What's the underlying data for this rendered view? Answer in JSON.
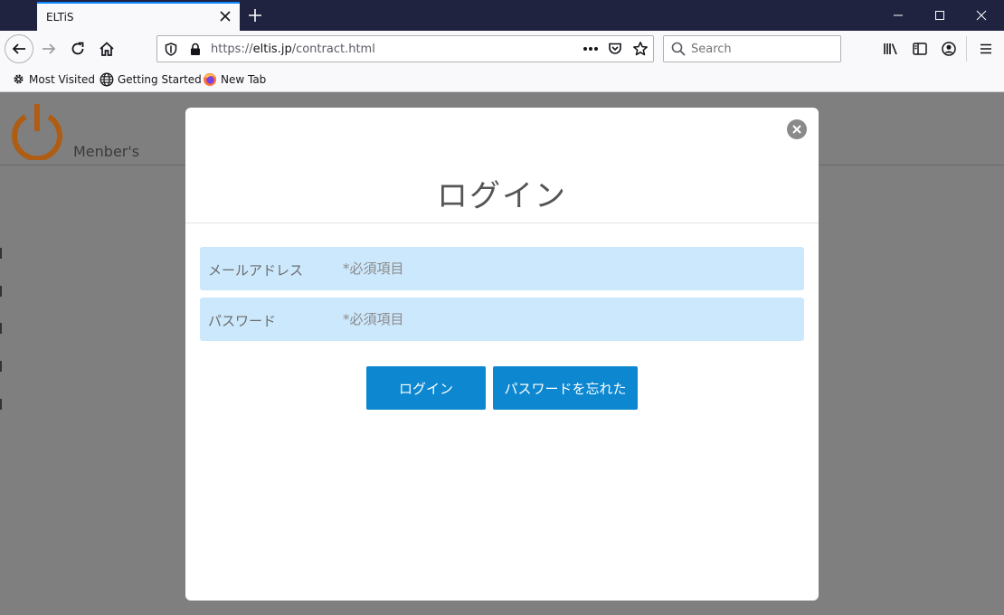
{
  "browser": {
    "tab_title": "ELTiS",
    "url_prefix": "https://",
    "url_domain": "eltis.jp",
    "url_path": "/contract.html",
    "search_placeholder": "Search",
    "bookmarks": [
      "Most Visited",
      "Getting Started",
      "New Tab"
    ]
  },
  "page": {
    "member_label": "Menber's"
  },
  "modal": {
    "title": "ログイン",
    "email_label": "メールアドレス",
    "email_placeholder": "*必須項目",
    "password_label": "パスワード",
    "password_placeholder": "*必須項目",
    "login_button": "ログイン",
    "forgot_button": "パスワードを忘れた"
  },
  "colors": {
    "accent": "#0c87d0",
    "field_bg": "#cce8fc",
    "logo": "#b45a08",
    "titlebar": "#202340"
  }
}
